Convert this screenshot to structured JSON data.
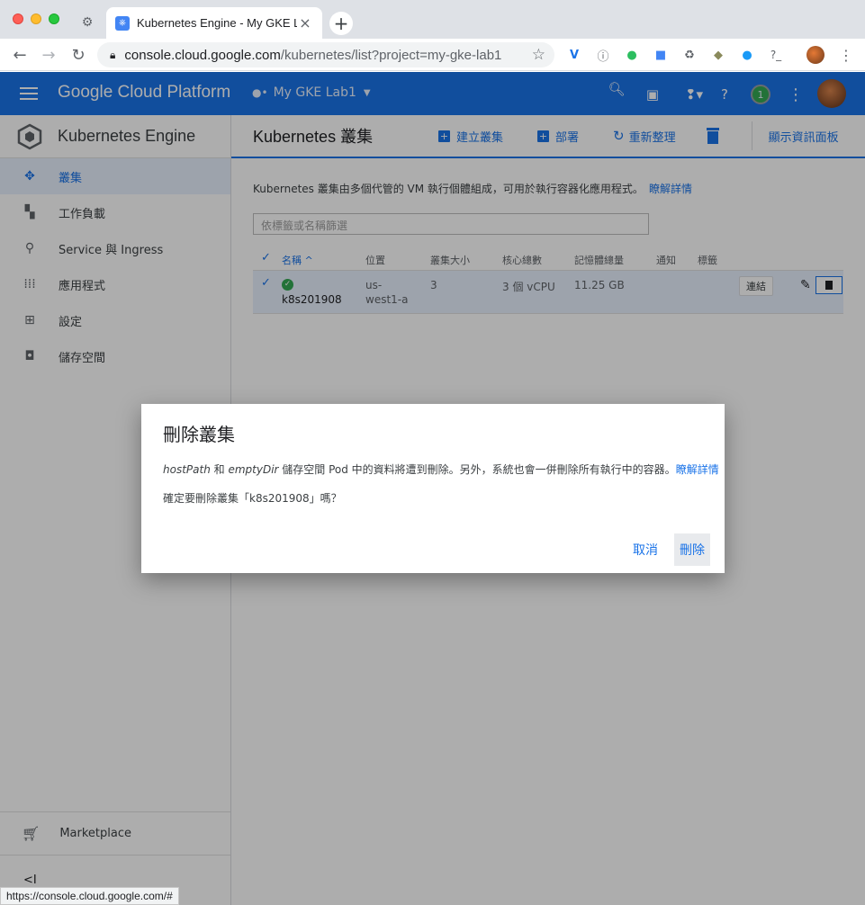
{
  "browser": {
    "tab_title": "Kubernetes Engine - My GKE L",
    "url_host": "console.cloud.google.com",
    "url_path": "/kubernetes/list?project=my-gke-lab1",
    "status_url": "https://console.cloud.google.com/#"
  },
  "header": {
    "logo": "Google Cloud Platform",
    "project": "My GKE Lab1",
    "notification_count": "1"
  },
  "sidebar": {
    "title": "Kubernetes Engine",
    "items": [
      {
        "label": "叢集",
        "icon": "clusters-icon",
        "active": true
      },
      {
        "label": "工作負載",
        "icon": "workloads-icon"
      },
      {
        "label": "Service 與 Ingress",
        "icon": "services-icon"
      },
      {
        "label": "應用程式",
        "icon": "applications-icon"
      },
      {
        "label": "設定",
        "icon": "configuration-icon"
      },
      {
        "label": "儲存空間",
        "icon": "storage-icon"
      }
    ],
    "marketplace": "Marketplace",
    "collapse": "<I"
  },
  "main": {
    "title": "Kubernetes 叢集",
    "actions": {
      "create": "建立叢集",
      "deploy": "部署",
      "refresh": "重新整理",
      "info_panel": "顯示資訊面板"
    },
    "description": "Kubernetes 叢集由多個代管的 VM 執行個體組成，可用於執行容器化應用程式。",
    "learn_more": "瞭解詳情",
    "filter_placeholder": "依標籤或名稱篩選",
    "table": {
      "columns": [
        "名稱 ^",
        "位置",
        "叢集大小",
        "核心總數",
        "記憶體總量",
        "通知",
        "標籤"
      ],
      "rows": [
        {
          "name": "k8s201908",
          "location_line1": "us-",
          "location_line2": "west1-a",
          "size": "3",
          "cores": "3 個 vCPU",
          "memory": "11.25 GB",
          "connect": "連結"
        }
      ]
    }
  },
  "dialog": {
    "title": "刪除叢集",
    "body_em1": "hostPath",
    "body_and": " 和 ",
    "body_em2": "emptyDir",
    "body_rest": " 儲存空間 Pod 中的資料將遭到刪除。另外，系統也會一併刪除所有執行中的容器。",
    "body_link": "瞭解詳情",
    "confirm_text": "確定要刪除叢集「k8s201908」嗎？",
    "cancel": "取消",
    "delete": "刪除"
  },
  "colors": {
    "accent": "#1a73e8",
    "status_ok": "#34a853"
  }
}
